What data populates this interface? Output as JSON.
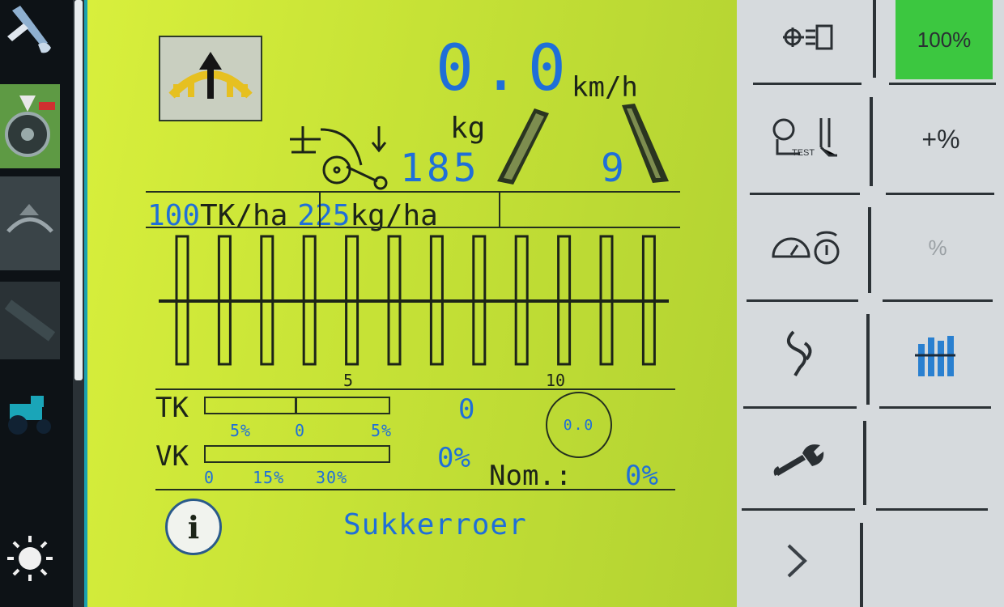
{
  "speed": {
    "value": "0.0",
    "unit": "km/h"
  },
  "hopper": {
    "label": "kg",
    "value": "185"
  },
  "right_boom_count": "9",
  "rates": [
    {
      "value": "100",
      "unit": "TK/ha"
    },
    {
      "value": "225",
      "unit": "kg/ha"
    }
  ],
  "sections": {
    "count": 12,
    "tick_labels": [
      "5",
      "10"
    ]
  },
  "tk": {
    "label": "TK",
    "scale": [
      "5%",
      "0",
      "5%"
    ],
    "value": "0"
  },
  "vk": {
    "label": "VK",
    "scale": [
      "0",
      "15%",
      "30%"
    ],
    "value": "0%"
  },
  "gauge_value": "0.0",
  "nominal": {
    "label": "Nom.:",
    "value": "0%"
  },
  "crop": "Sukkerroer",
  "info_label": "i",
  "right_panel": {
    "percent_button": "100%",
    "plus_percent_button": "+%",
    "test_label": "TEST",
    "reset_percent_label": "%",
    "selected_color": "#3cc740"
  },
  "icons": {
    "left_strip": [
      "wrench-icon",
      "navigation-icon",
      "fertilizer-icon",
      "field-icon",
      "tractor-icon",
      "brightness-icon"
    ],
    "right_panel": [
      "light-icon",
      "calibration-test-icon",
      "speed-wheel-icon",
      "hydraulic-icon",
      "section-bars-icon",
      "wrench-icon",
      "next-arrow-icon"
    ]
  }
}
